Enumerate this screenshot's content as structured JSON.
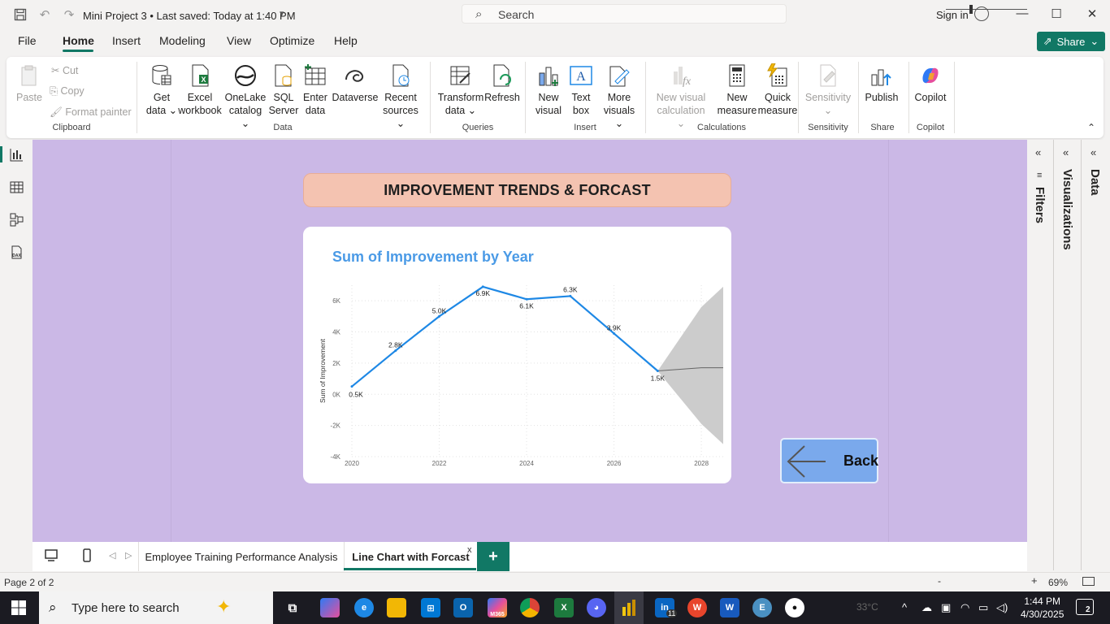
{
  "titlebar": {
    "doc_title": "Mini Project 3 • Last saved: Today at 1:40 PM",
    "search_placeholder": "Search",
    "signin_label": "Sign in"
  },
  "menu": {
    "file": "File",
    "home": "Home",
    "insert": "Insert",
    "modeling": "Modeling",
    "view": "View",
    "optimize": "Optimize",
    "help": "Help",
    "share": "Share"
  },
  "ribbon": {
    "clipboard": {
      "paste": "Paste",
      "cut": "Cut",
      "copy": "Copy",
      "format_painter": "Format painter",
      "group": "Clipboard"
    },
    "data": {
      "get_data": [
        "Get",
        "data ⌄"
      ],
      "excel": [
        "Excel",
        "workbook"
      ],
      "onelake": [
        "OneLake",
        "catalog ⌄"
      ],
      "sql": [
        "SQL",
        "Server"
      ],
      "enter": [
        "Enter",
        "data"
      ],
      "dataverse": [
        "Dataverse",
        ""
      ],
      "recent": [
        "Recent",
        "sources ⌄"
      ],
      "group": "Data"
    },
    "queries": {
      "transform": [
        "Transform",
        "data ⌄"
      ],
      "refresh": [
        "Refresh",
        ""
      ],
      "group": "Queries"
    },
    "insert": {
      "new_visual": [
        "New",
        "visual"
      ],
      "text_box": [
        "Text",
        "box"
      ],
      "more_visuals": [
        "More",
        "visuals ⌄"
      ],
      "group": "Insert"
    },
    "calculations": {
      "new_visual_calc": [
        "New visual",
        "calculation ⌄"
      ],
      "new_measure": [
        "New",
        "measure"
      ],
      "quick_measure": [
        "Quick",
        "measure"
      ],
      "group": "Calculations"
    },
    "sensitivity": {
      "label": [
        "Sensitivity",
        "⌄"
      ],
      "group": "Sensitivity"
    },
    "share": {
      "publish": [
        "Publish",
        ""
      ],
      "group": "Share"
    },
    "copilot": {
      "copilot": [
        "Copilot",
        ""
      ],
      "group": "Copilot"
    }
  },
  "report": {
    "title": "IMPROVEMENT TRENDS & FORCAST",
    "back_label": "Back"
  },
  "chart_data": {
    "type": "line",
    "title": "Sum of Improvement by Year",
    "xlabel": "",
    "ylabel": "Sum of Improvement",
    "x": [
      2020,
      2021,
      2022,
      2023,
      2024,
      2025,
      2026,
      2027
    ],
    "values": [
      500,
      2800,
      5000,
      6900,
      6100,
      6300,
      3900,
      1500
    ],
    "data_labels": [
      "0.5K",
      "2.8K",
      "5.0K",
      "6.9K",
      "6.1K",
      "6.3K",
      "3.9K",
      "1.5K"
    ],
    "forecast": {
      "x": [
        2027,
        2028,
        2028.5
      ],
      "values": [
        1500,
        1700,
        1700
      ],
      "upper": [
        1500,
        5600,
        6900
      ],
      "lower": [
        1500,
        -1900,
        -3200
      ]
    },
    "xlim": [
      2020,
      2028.5
    ],
    "ylim": [
      -4000,
      7000
    ],
    "xticks": [
      2020,
      2022,
      2024,
      2026,
      2028
    ],
    "xtick_labels": [
      "2020",
      "2022",
      "2024",
      "2026",
      "2028"
    ],
    "yticks": [
      -4000,
      -2000,
      0,
      2000,
      4000,
      6000
    ],
    "ytick_labels": [
      "-4K",
      "-2K",
      "0K",
      "2K",
      "4K",
      "6K"
    ],
    "grid": true,
    "line_color": "#1e88e5",
    "forecast_band_color": "#cccccc",
    "forecast_line_color": "#666666"
  },
  "panes": {
    "filters": "Filters",
    "visualizations": "Visualizations",
    "data": "Data"
  },
  "pages": {
    "tabs": [
      "Employee Training Performance Analysis",
      "Line Chart with Forcast"
    ],
    "close_glyph": "x",
    "add_glyph": "+"
  },
  "status": {
    "page_count": "Page 2 of 2",
    "zoom": "69%"
  },
  "taskbar": {
    "search_placeholder": "Type here to search",
    "time": "1:44 PM",
    "date": "4/30/2025",
    "weather": "33°C",
    "notif_count": "2",
    "linkedin_badge": "11",
    "m365_label": "M365"
  },
  "colors": {
    "accent": "#117865",
    "canvas": "#cbb8e6",
    "title_banner": "#f4c3b1",
    "back_button": "#7aa9ec"
  }
}
